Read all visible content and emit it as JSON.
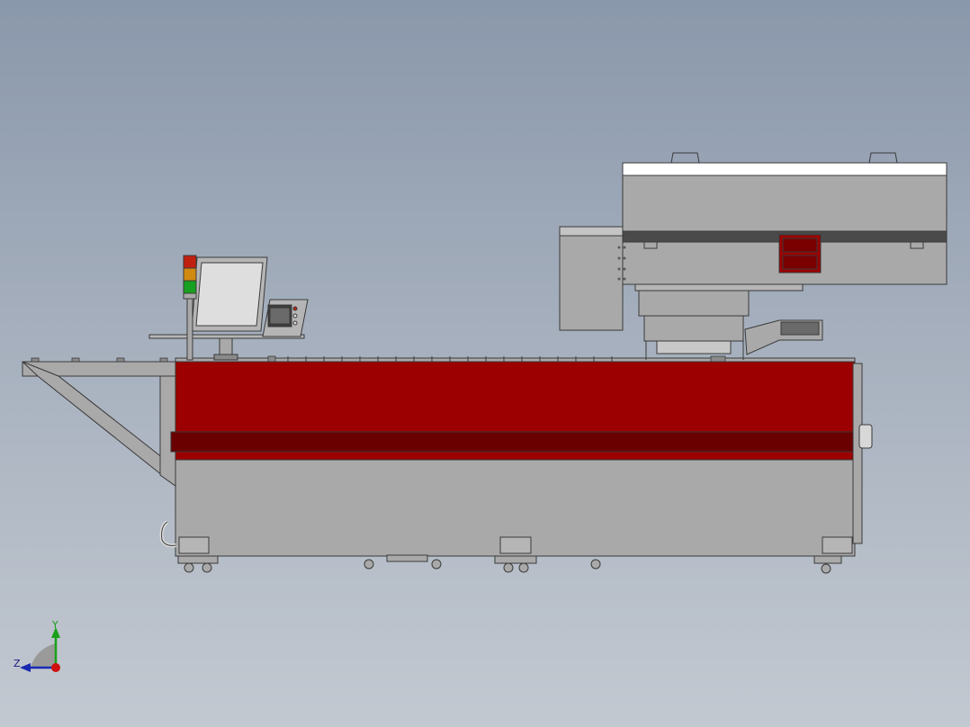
{
  "viewport": {
    "background_top": "#8a98ab",
    "background_bottom": "#c3c9d1"
  },
  "machine": {
    "body_color": "#9c0000",
    "body_band_color": "#6a0000",
    "frame_color": "#a9a9a9",
    "light_gray": "#b5b5b5",
    "outline_color": "#3a3a3a",
    "signal_tower_colors": [
      "#c02010",
      "#d08a10",
      "#18a020"
    ]
  },
  "triad": {
    "y_label": "Y",
    "z_label": "Z",
    "y_color": "#1aa01a",
    "z_color": "#1a2ab0",
    "x_color": "#d01010"
  }
}
